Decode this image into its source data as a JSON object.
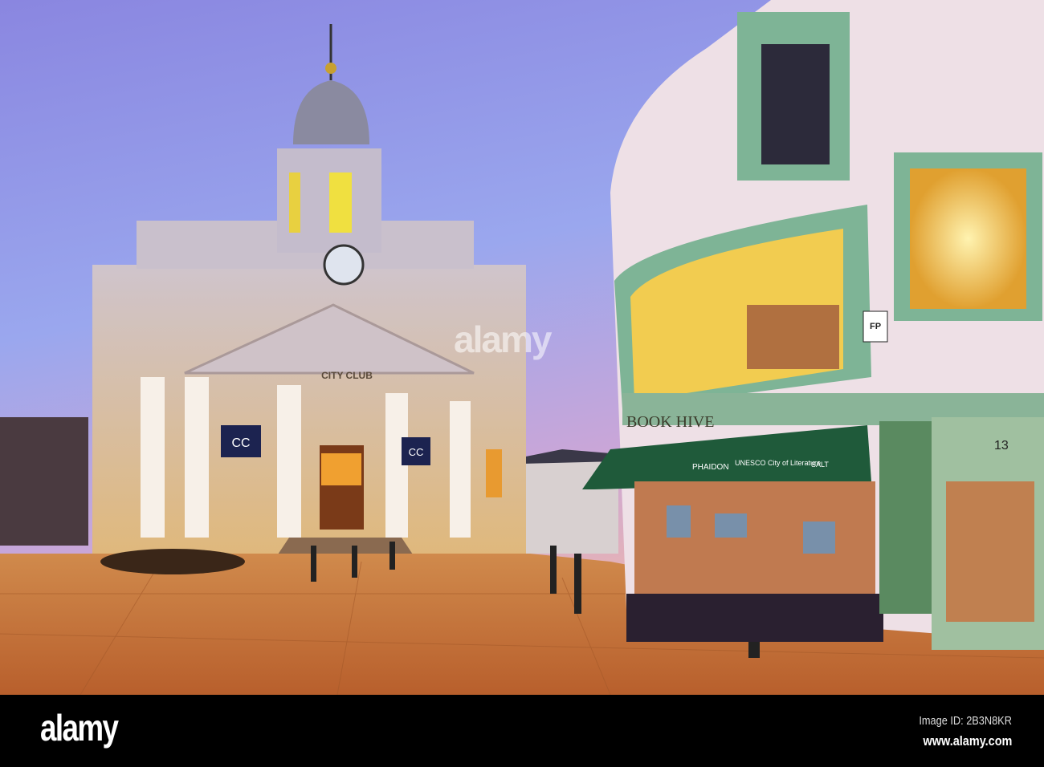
{
  "photo": {
    "signs": {
      "city_club": "CITY CLUB",
      "book_hive": "BOOK HIVE",
      "awning_publisher": "PHAIDON",
      "awning_unesco": "UNESCO City of Literature",
      "awning_salt": "SALT",
      "door_number": "13",
      "plaque": "FP",
      "club_banner": "CC"
    },
    "watermark": "alamy"
  },
  "footer": {
    "logo": "alamy",
    "image_id": "Image ID: 2B3N8KR",
    "url": "www.alamy.com"
  },
  "colors": {
    "sky_top": "#7f8fe0",
    "sky_bottom": "#e8a6c0",
    "pavement": "#c8763a",
    "shop_green": "#1f5a3a"
  }
}
